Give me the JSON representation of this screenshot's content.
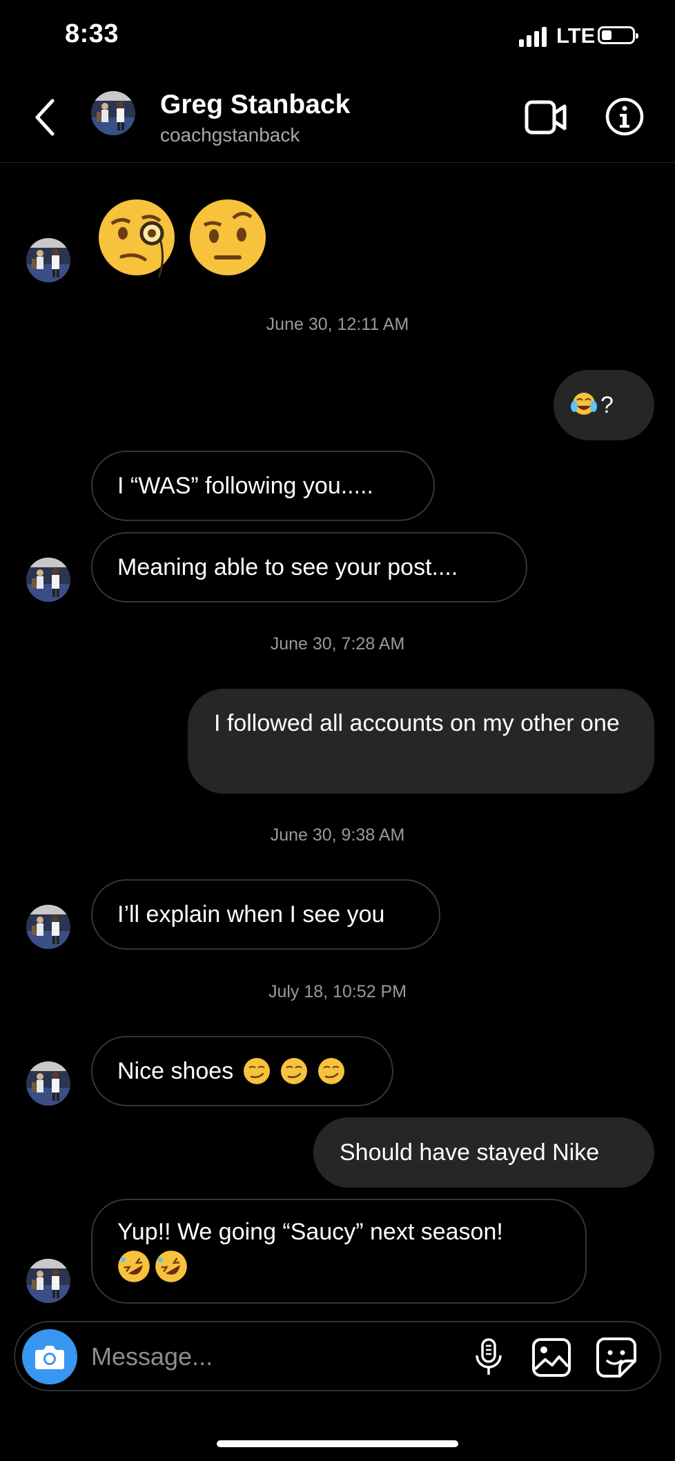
{
  "status_bar": {
    "time": "8:33",
    "network": "LTE",
    "battery_icon": "battery-icon",
    "signal_icon": "signal-bars-icon"
  },
  "header": {
    "name": "Greg Stanback",
    "username": "coachgstanback",
    "icons": {
      "back": "chevron-left-icon",
      "video": "video-camera-icon",
      "info": "info-icon"
    }
  },
  "thread": {
    "emoji_reaction": [
      "face-with-monocle",
      "face-with-raised-eyebrow"
    ],
    "timestamps": [
      "June 30, 12:11 AM",
      "June 30, 7:28 AM",
      "June 30, 9:38 AM",
      "July 18, 10:52 PM"
    ],
    "messages": [
      {
        "from": "me",
        "emoji": "face-with-tears-of-joy",
        "text": "?"
      },
      {
        "from": "them",
        "text": "I “WAS” following you....."
      },
      {
        "from": "them",
        "text": "Meaning able to see your post...."
      },
      {
        "from": "me",
        "text": "I followed all accounts on my other one"
      },
      {
        "from": "them",
        "text": "I’ll explain when I see you"
      },
      {
        "from": "them",
        "text": "Nice shoes",
        "emojis": [
          "smirking-face",
          "smirking-face",
          "smirking-face"
        ]
      },
      {
        "from": "me",
        "text": "Should have stayed Nike"
      },
      {
        "from": "them",
        "text": "Yup!! We going “Saucy” next season!",
        "emojis": [
          "rolling-on-floor-laughing",
          "rolling-on-floor-laughing"
        ]
      }
    ]
  },
  "composer": {
    "placeholder": "Message...",
    "icons": [
      "camera-icon",
      "microphone-icon",
      "gallery-icon",
      "sticker-icon"
    ]
  },
  "colors": {
    "background": "#000000",
    "bubble_out": "#262626",
    "bubble_in_border": "#363636",
    "camera_button": "#3897f0",
    "muted_text": "#9a9a9a"
  }
}
